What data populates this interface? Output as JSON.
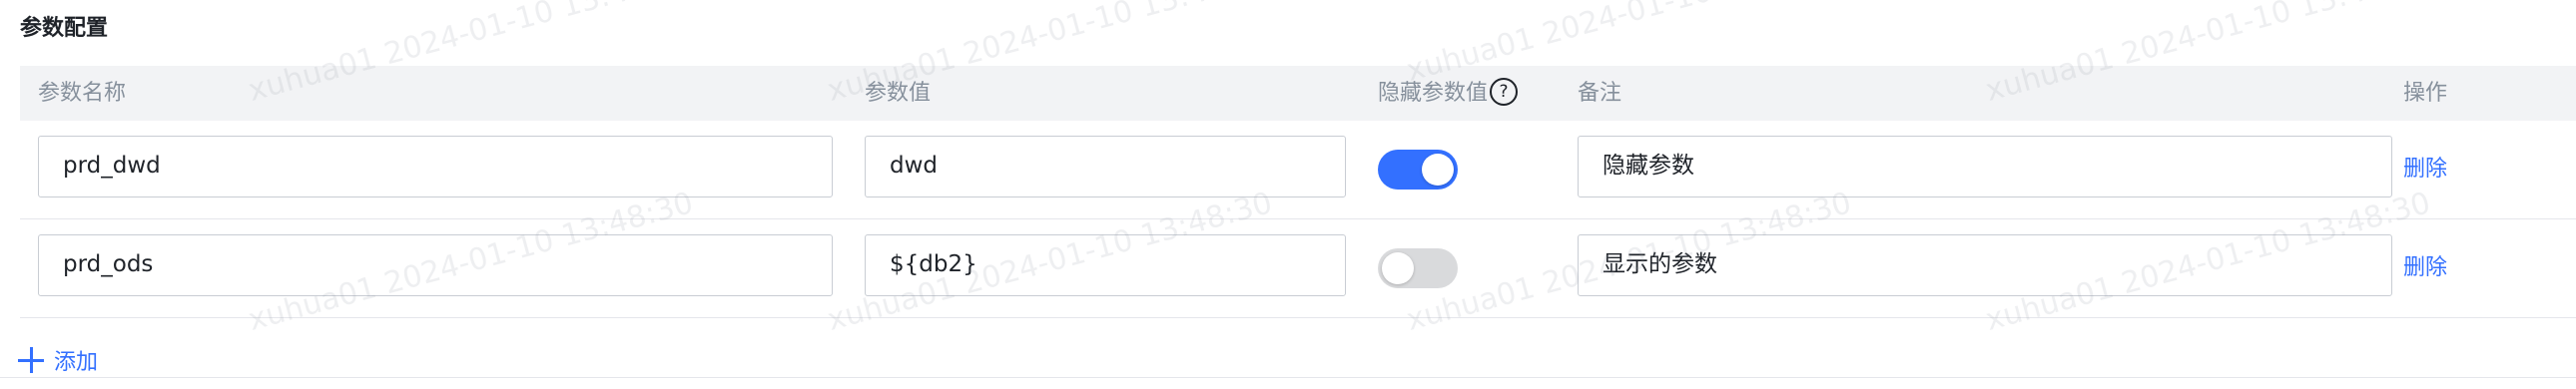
{
  "section": {
    "title": "参数配置"
  },
  "table": {
    "headers": {
      "name": "参数名称",
      "value": "参数值",
      "hidden": "隐藏参数值",
      "remark": "备注",
      "operation": "操作"
    },
    "help_icon_glyph": "?",
    "rows": [
      {
        "name": "prd_dwd",
        "value": "dwd",
        "hidden": true,
        "remark": "隐藏参数",
        "delete_label": "删除"
      },
      {
        "name": "prd_ods",
        "value": "${db2}",
        "hidden": false,
        "remark": "显示的参数",
        "delete_label": "删除"
      }
    ]
  },
  "add": {
    "label": "添加",
    "icon": "plus-icon"
  },
  "watermark": {
    "text": "xuhua01 2024-01-10 13:48:30"
  },
  "colors": {
    "accent": "#3370ff",
    "header_bg": "#f2f3f5",
    "toggle_off": "#d9dadc"
  }
}
